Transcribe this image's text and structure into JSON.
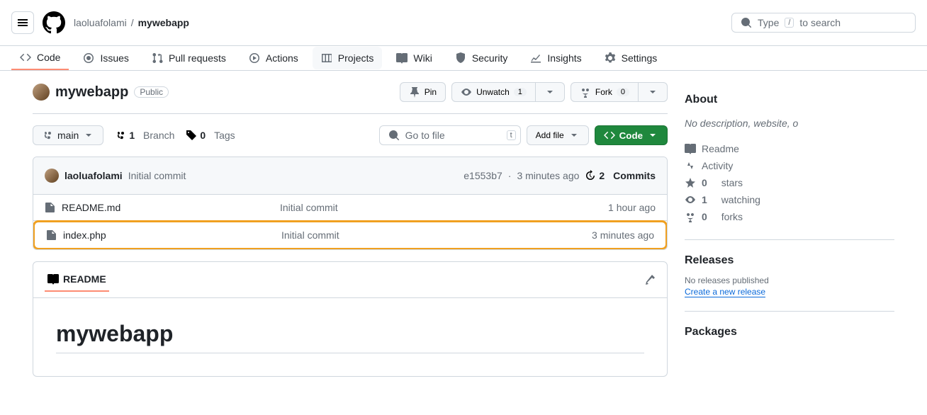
{
  "header": {
    "owner": "laoluafolami",
    "repo": "mywebapp",
    "search_placeholder": "Type",
    "search_suffix": "to search",
    "search_kbd": "/"
  },
  "tabs": {
    "code": "Code",
    "issues": "Issues",
    "pulls": "Pull requests",
    "actions": "Actions",
    "projects": "Projects",
    "wiki": "Wiki",
    "security": "Security",
    "insights": "Insights",
    "settings": "Settings"
  },
  "repo": {
    "title": "mywebapp",
    "visibility": "Public",
    "pin": "Pin",
    "unwatch": "Unwatch",
    "unwatch_count": "1",
    "fork": "Fork",
    "fork_count": "0"
  },
  "toolbar": {
    "branch": "main",
    "branch_count": "1",
    "branch_label": "Branch",
    "tag_count": "0",
    "tag_label": "Tags",
    "goto_placeholder": "Go to file",
    "goto_kbd": "t",
    "addfile": "Add file",
    "code": "Code"
  },
  "commitbar": {
    "author": "laoluafolami",
    "message": "Initial commit",
    "sha": "e1553b7",
    "time": "3 minutes ago",
    "commits_count": "2",
    "commits_label": "Commits"
  },
  "files": [
    {
      "name": "README.md",
      "msg": "Initial commit",
      "time": "1 hour ago"
    },
    {
      "name": "index.php",
      "msg": "Initial commit",
      "time": "3 minutes ago"
    }
  ],
  "readme": {
    "tab": "README",
    "title": "mywebapp"
  },
  "about": {
    "heading": "About",
    "desc": "No description, website, o",
    "readme": "Readme",
    "activity": "Activity",
    "stars_count": "0",
    "stars_label": "stars",
    "watching_count": "1",
    "watching_label": "watching",
    "forks_count": "0",
    "forks_label": "forks"
  },
  "releases": {
    "heading": "Releases",
    "none": "No releases published",
    "create": "Create a new release"
  },
  "packages": {
    "heading": "Packages"
  }
}
